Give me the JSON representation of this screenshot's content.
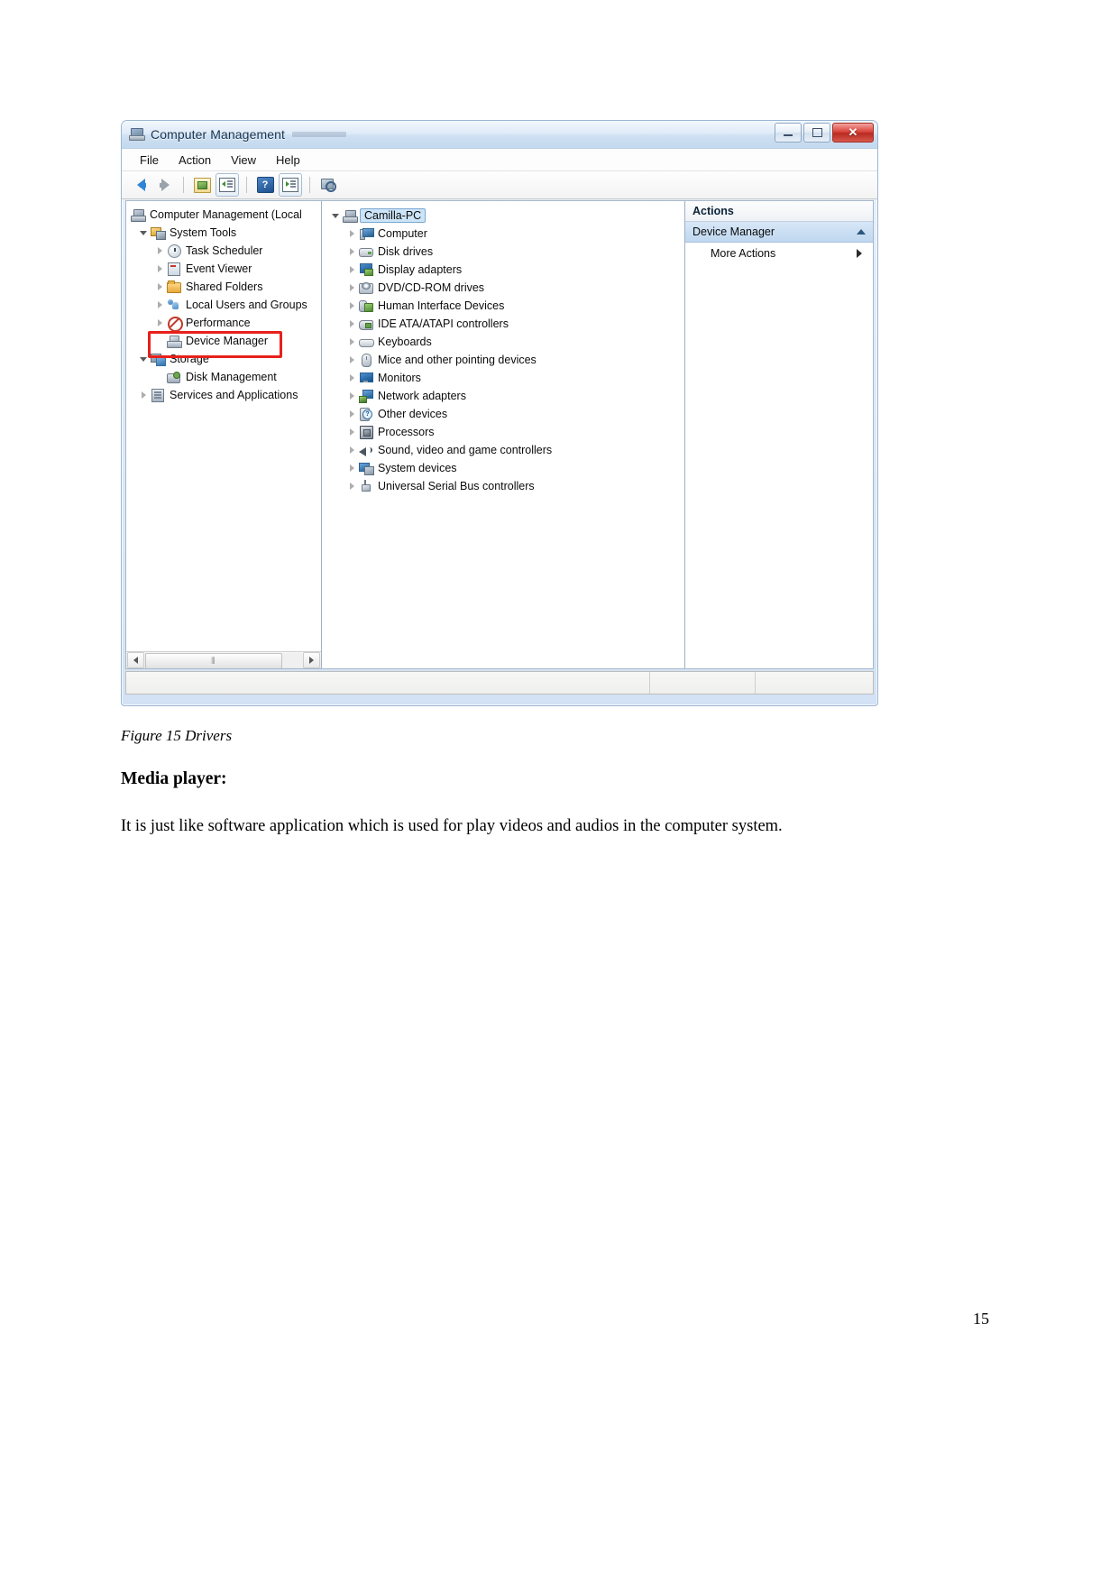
{
  "window": {
    "title": "Computer Management",
    "icon": "computer-management-icon",
    "buttons": {
      "minimize": "minimize-button",
      "maximize": "maximize-button",
      "close_label": "✕"
    },
    "menu": [
      "File",
      "Action",
      "View",
      "Help"
    ],
    "toolbar": [
      "back-arrow-icon",
      "forward-arrow-icon",
      "show-hide-console-tree-icon",
      "show-hide-action-pane-icon",
      "help-icon",
      "show-hide-details-icon",
      "refresh-scan-icon"
    ]
  },
  "tree": {
    "root": "Computer Management (Local",
    "items": [
      {
        "label": "System Tools",
        "icon": "system-tools-icon",
        "indent": 1,
        "expander": "open"
      },
      {
        "label": "Task Scheduler",
        "icon": "task-scheduler-icon",
        "indent": 2,
        "expander": "closed"
      },
      {
        "label": "Event Viewer",
        "icon": "event-viewer-icon",
        "indent": 2,
        "expander": "closed"
      },
      {
        "label": "Shared Folders",
        "icon": "shared-folders-icon",
        "indent": 2,
        "expander": "closed"
      },
      {
        "label": "Local Users and Groups",
        "icon": "local-users-icon",
        "indent": 2,
        "expander": "closed"
      },
      {
        "label": "Performance",
        "icon": "performance-icon",
        "indent": 2,
        "expander": "closed"
      },
      {
        "label": "Device Manager",
        "icon": "device-manager-icon",
        "indent": 2,
        "expander": "none",
        "highlighted": true
      },
      {
        "label": "Storage",
        "icon": "storage-icon",
        "indent": 1,
        "expander": "open"
      },
      {
        "label": "Disk Management",
        "icon": "disk-management-icon",
        "indent": 2,
        "expander": "none"
      },
      {
        "label": "Services and Applications",
        "icon": "services-icon",
        "indent": 1,
        "expander": "closed"
      }
    ],
    "scrollbar": {
      "left_arrow": "scroll-left-icon",
      "right_arrow": "scroll-right-icon",
      "grip": "⦀"
    }
  },
  "devices": {
    "root": {
      "label": "Camilla-PC",
      "icon": "computer-node-icon",
      "expander": "open",
      "selected": true
    },
    "items": [
      {
        "label": "Computer",
        "icon": "computer-icon"
      },
      {
        "label": "Disk drives",
        "icon": "disk-drives-icon"
      },
      {
        "label": "Display adapters",
        "icon": "display-adapters-icon"
      },
      {
        "label": "DVD/CD-ROM drives",
        "icon": "dvd-cdrom-icon"
      },
      {
        "label": "Human Interface Devices",
        "icon": "human-interface-icon"
      },
      {
        "label": "IDE ATA/ATAPI controllers",
        "icon": "ide-ata-icon"
      },
      {
        "label": "Keyboards",
        "icon": "keyboard-icon"
      },
      {
        "label": "Mice and other pointing devices",
        "icon": "mouse-icon"
      },
      {
        "label": "Monitors",
        "icon": "monitor-icon"
      },
      {
        "label": "Network adapters",
        "icon": "network-adapter-icon"
      },
      {
        "label": "Other devices",
        "icon": "other-devices-icon"
      },
      {
        "label": "Processors",
        "icon": "processor-icon"
      },
      {
        "label": "Sound, video and game controllers",
        "icon": "sound-video-icon"
      },
      {
        "label": "System devices",
        "icon": "system-devices-icon"
      },
      {
        "label": "Universal Serial Bus controllers",
        "icon": "usb-controllers-icon"
      }
    ]
  },
  "actions": {
    "header": "Actions",
    "selected_title": "Device Manager",
    "collapse_icon": "chevron-up-icon",
    "rows": [
      {
        "label": "More Actions",
        "submenu_icon": "chevron-right-icon"
      }
    ]
  },
  "document": {
    "caption": "Figure 15 Drivers",
    "heading": "Media player:",
    "paragraph": "It is just like software application which is used for play videos and audios in the computer system.",
    "page_number": "15"
  },
  "colors": {
    "highlight_box": "#e8201b",
    "selection_blue": "#cce4f7",
    "title_bar": "#c3d9ef",
    "close_button": "#d9453c"
  }
}
